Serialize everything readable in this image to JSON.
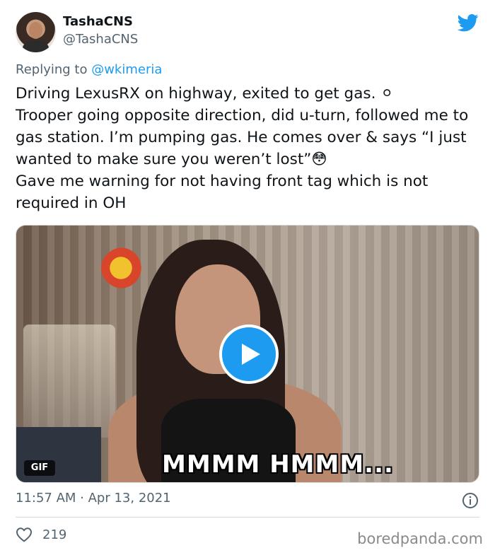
{
  "author": {
    "display_name": "TashaCNS",
    "handle": "@TashaCNS"
  },
  "reply": {
    "prefix": "Replying to ",
    "mention": "@wkimeria"
  },
  "tweet": {
    "text": "Driving LexusRX on highway, exited to get gas. ⚪\nTrooper going opposite direction, did u-turn, followed me to gas station. I’m pumping gas. He comes over & says “I just wanted to make sure you weren’t lost”😳\n Gave me warning for not having front tag which is not required in OH",
    "media_caption": "MMMM HMMM...",
    "media_badge": "GIF",
    "timestamp": "11:57 AM · Apr 13, 2021",
    "like_count": "219"
  },
  "icons": {
    "brand": "twitter-bird-icon",
    "play": "play-icon",
    "info": "info-icon",
    "like": "heart-icon"
  },
  "colors": {
    "accent": "#1d9bf0",
    "secondary_text": "#536471",
    "primary_text": "#0f1419"
  },
  "watermark": "boredpanda.com"
}
